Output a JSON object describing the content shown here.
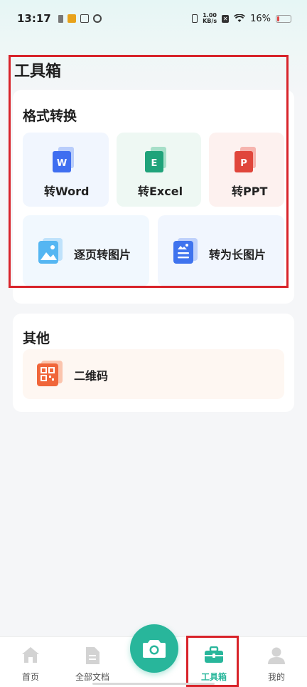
{
  "status_bar": {
    "time": "13:17",
    "net_speed_value": "1.00",
    "net_speed_unit": "KB/s",
    "battery": "16%"
  },
  "page": {
    "title": "工具箱"
  },
  "format_section": {
    "title": "格式转换",
    "tiles": [
      {
        "label": "转Word",
        "icon_letter": "W",
        "icon": "word-icon"
      },
      {
        "label": "转Excel",
        "icon_letter": "E",
        "icon": "excel-icon"
      },
      {
        "label": "转PPT",
        "icon_letter": "P",
        "icon": "ppt-icon"
      },
      {
        "label": "逐页转图片",
        "icon": "image-icon"
      },
      {
        "label": "转为长图片",
        "icon": "long-image-icon"
      }
    ]
  },
  "other_section": {
    "title": "其他",
    "items": [
      {
        "label": "二维码",
        "icon": "qrcode-icon"
      }
    ]
  },
  "bottom_nav": {
    "items": [
      {
        "label": "首页",
        "icon": "home-icon"
      },
      {
        "label": "全部文档",
        "icon": "document-icon"
      },
      {
        "label": "工具箱",
        "icon": "toolbox-icon",
        "active": true
      },
      {
        "label": "我的",
        "icon": "user-icon"
      }
    ],
    "camera_icon": "camera-icon"
  },
  "colors": {
    "accent": "#28b69b",
    "highlight": "#d8232a",
    "word": "#3f6ef0",
    "excel": "#1fa37a",
    "ppt": "#e0463b",
    "qrcode": "#f0663a"
  }
}
